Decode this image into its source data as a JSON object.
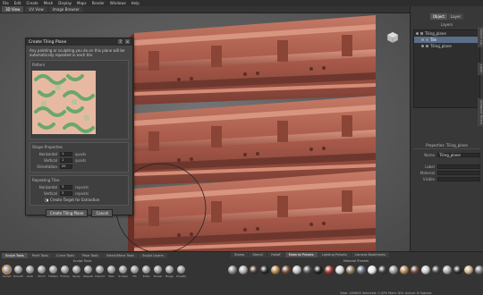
{
  "menubar": [
    "File",
    "Edit",
    "Create",
    "Mesh",
    "Display",
    "Maps",
    "Render",
    "Windows",
    "Help"
  ],
  "view_tabs": [
    "3D View",
    "UV View",
    "Image Browser"
  ],
  "dialog": {
    "title": "Create Tiling Plane",
    "help_glyph": "?",
    "close_glyph": "×",
    "description": "Any painting or sculpting you do on this plane will be automatically repeated in each tile.",
    "preview_title": "Pattern",
    "shape_title": "Shape Properties",
    "horizontal_label": "Horizontal",
    "horizontal_value": "1",
    "horizontal_unit": "quads",
    "vertical_label": "Vertical",
    "vertical_value": "1",
    "vertical_unit": "quads",
    "orientation_label": "Orientation",
    "orientation_value": "XY",
    "repeat_title": "Repeating Tiles",
    "rep_h_label": "Horizontal",
    "rep_h_value": "3",
    "rep_h_unit": "repeats",
    "rep_v_label": "Vertical",
    "rep_v_value": "3",
    "rep_v_unit": "repeats",
    "checkbox_label": "Create Target for Extraction",
    "create_button": "Create Tiling Plane",
    "cancel_button": "Cancel"
  },
  "right_panel": {
    "tabs": [
      "Object",
      "Layer"
    ],
    "header": "Layers",
    "outliner": [
      {
        "label": "Tiling_plane"
      },
      {
        "label": "Tile"
      },
      {
        "label": "Tiling_plane"
      }
    ],
    "properties_title": "Properties: Tiling_plane",
    "name_label": "Name",
    "name_value": "Tiling_plane",
    "rows": [
      {
        "label": "Label",
        "value": ""
      },
      {
        "label": "Material",
        "value": ""
      },
      {
        "label": "Visible",
        "value": ""
      }
    ],
    "side_tabs": [
      "Object List",
      "Layer",
      "Viewport Filters"
    ]
  },
  "bottom": {
    "tool_tabs": [
      "Sculpt Tools",
      "Paint Tools",
      "Curve Tools",
      "Pose Tools",
      "Select/Move Tools",
      "Sculpt Layers"
    ],
    "shelf_tabs": [
      "Stamp",
      "Stencil",
      "Falloff",
      "Material Presets",
      "Lighting Presets",
      "Camera Bookmarks"
    ],
    "tools_label": "Sculpt Tools",
    "presets_label": "Material Presets",
    "tools": [
      "Sculpt",
      "Smooth",
      "Grab",
      "Pinch",
      "Flatten",
      "Foamy",
      "Spray",
      "Repeat",
      "Imprint",
      "Wax",
      "Scrape",
      "Fill",
      "Knife",
      "Smear",
      "Bulge",
      "Amplify"
    ],
    "status": "Total: 409600  Selected: 0 GPU Mem: 851  Active: 6  Highest"
  },
  "colors": {
    "accent": "#e08a3a",
    "tile_base": "#b96a5a",
    "selection": "#5a6e8a",
    "pattern_bg": "#e7b9a3",
    "pattern_fg": "#6aa86a"
  },
  "material_balls": [
    "#8a8a8a",
    "#b0b0b0",
    "#4b3a2f",
    "#2a2a2a",
    "#b7874f",
    "#7a4e38",
    "#c0c0c0",
    "#555555",
    "#222222",
    "#a13a2c",
    "#d6d6d6",
    "#8f7a5f",
    "#666f7a",
    "#e5e5e5",
    "#3f3f3f",
    "#9b9b9b",
    "#b5875a",
    "#6f4a3a",
    "#cccccc",
    "#444444",
    "#a8a8a8",
    "#2f2f2f",
    "#c9b28b",
    "#777777",
    "#5f3b2d"
  ]
}
